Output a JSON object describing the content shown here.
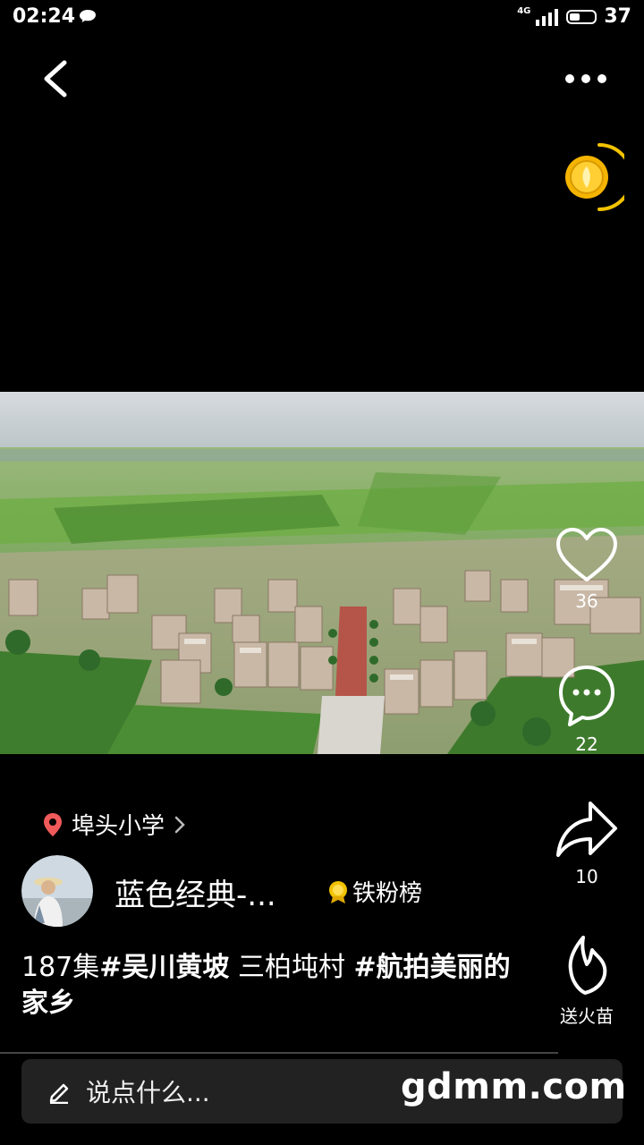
{
  "status_bar": {
    "time": "02:24",
    "network": "4G",
    "battery": "37"
  },
  "location": {
    "label": "埠头小学"
  },
  "author": {
    "name": "蓝色经典-...",
    "fans_rank": "铁粉榜"
  },
  "caption": {
    "part1": "187集",
    "tag1": "#吴川黄坡",
    "part2": "  三柏坉村 ",
    "tag2": "#航拍美丽的家乡"
  },
  "actions": {
    "likes": "36",
    "comments": "22",
    "shares": "10",
    "fire_label": "送火苗"
  },
  "comment_input": {
    "placeholder": "说点什么..."
  },
  "watermark": "gdmm.com",
  "colors": {
    "background": "#000000",
    "coin_ring": "#f2c200",
    "location_pin": "#f05a5a"
  }
}
